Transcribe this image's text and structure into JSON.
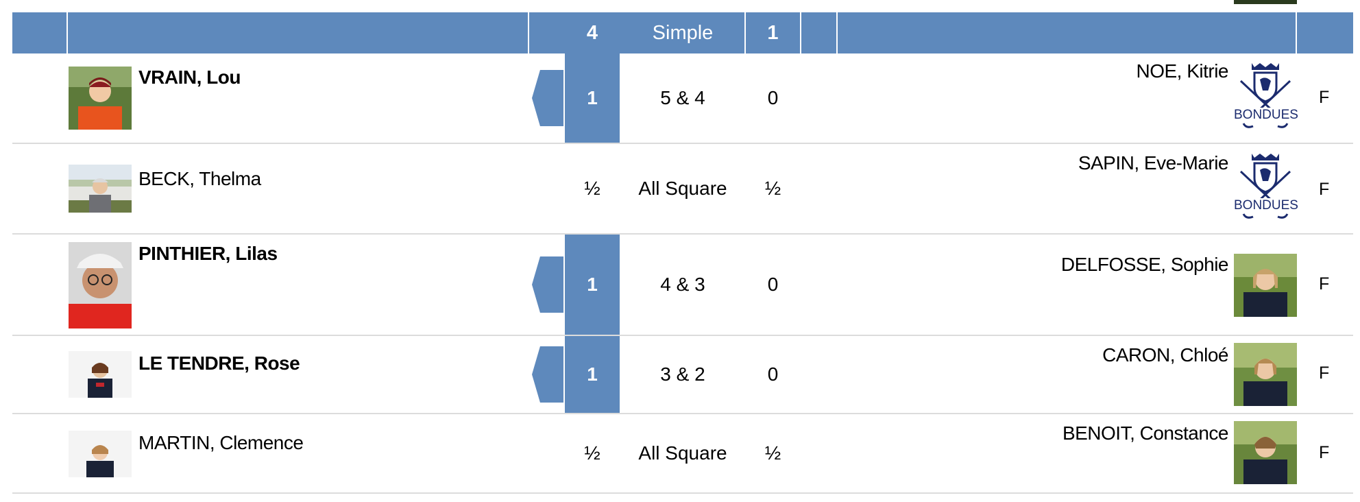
{
  "header": {
    "team_left_points": "4",
    "format": "Simple",
    "team_right_points": "1"
  },
  "colors": {
    "accent_blue": "#5e89bc",
    "club_navy": "#1b2b6e",
    "row_divider": "#dcdcdc"
  },
  "matches": [
    {
      "left_player": "VRAIN, Lou",
      "left_score": "1",
      "result": "5 & 4",
      "right_score": "0",
      "right_player": "NOE, Kitrie",
      "right_badge": "BONDUES",
      "gender": "F",
      "left_won": true
    },
    {
      "left_player": "BECK, Thelma",
      "left_score": "½",
      "result": "All Square",
      "right_score": "½",
      "right_player": "SAPIN, Eve-Marie",
      "right_badge": "BONDUES",
      "gender": "F",
      "left_won": false
    },
    {
      "left_player": "PINTHIER, Lilas",
      "left_score": "1",
      "result": "4 & 3",
      "right_score": "0",
      "right_player": "DELFOSSE, Sophie",
      "gender": "F",
      "left_won": true
    },
    {
      "left_player": "LE TENDRE, Rose",
      "left_score": "1",
      "result": "3 & 2",
      "right_score": "0",
      "right_player": "CARON, Chloé",
      "gender": "F",
      "left_won": true
    },
    {
      "left_player": "MARTIN, Clemence",
      "left_score": "½",
      "result": "All Square",
      "right_score": "½",
      "right_player": "BENOIT, Constance",
      "gender": "F",
      "left_won": false
    }
  ]
}
